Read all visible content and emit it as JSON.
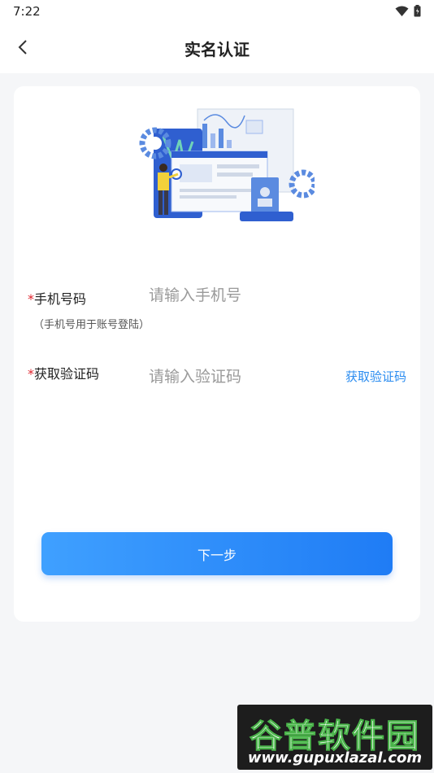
{
  "status": {
    "time": "7:22"
  },
  "header": {
    "title": "实名认证"
  },
  "form": {
    "phone": {
      "required_mark": "*",
      "label": "手机号码",
      "hint": "（手机号用于账号登陆）",
      "placeholder": "请输入手机号"
    },
    "code": {
      "required_mark": "*",
      "label": "获取验证码",
      "placeholder": "请输入验证码",
      "get_code_label": "获取验证码"
    },
    "next_label": "下一步"
  },
  "watermark": {
    "logo": "谷普软件园",
    "url": "www.gupuxlazal.com"
  },
  "colors": {
    "accent": "#2a8cf0",
    "required": "#e0262f",
    "button_start": "#3fa0ff",
    "button_end": "#1f7cf5"
  }
}
